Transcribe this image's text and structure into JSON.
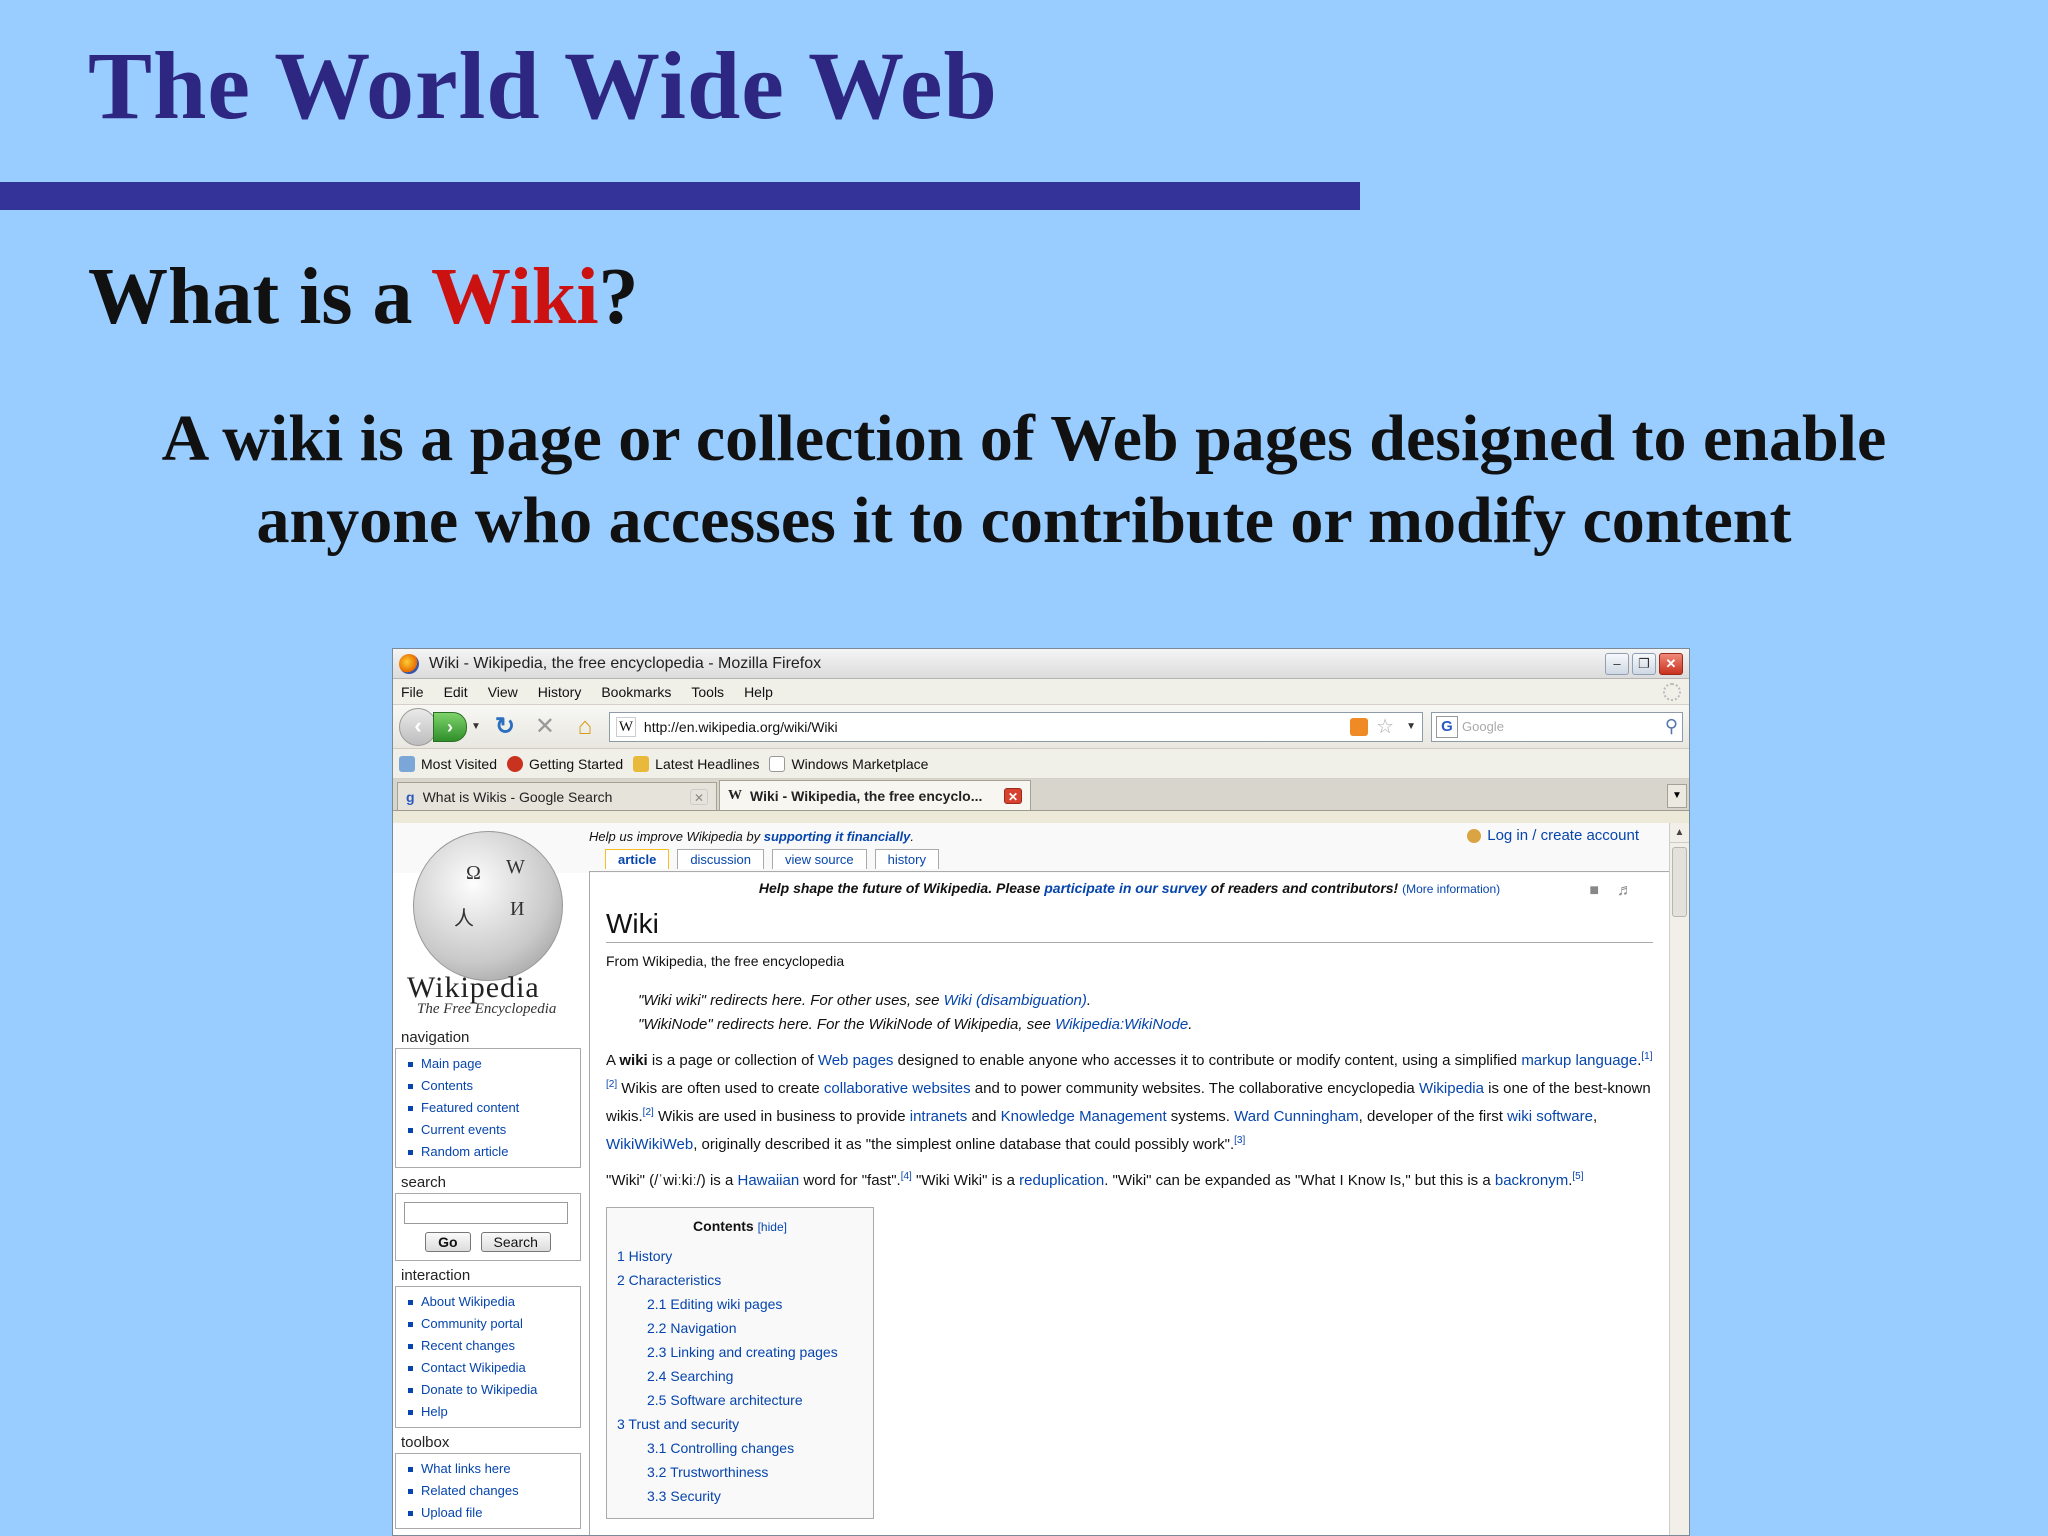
{
  "slide": {
    "title": "The World Wide Web",
    "subtitle_prefix": "What is a ",
    "subtitle_highlight": "Wiki",
    "subtitle_suffix": "?",
    "description_line1": "A wiki is a page or collection of Web pages designed to enable",
    "description_line2": "anyone who accesses it to contribute or modify content",
    "colors": {
      "title": "#2e2782",
      "rule": "#333399",
      "highlight": "#cc1111",
      "background": "#99ccff"
    }
  },
  "browser": {
    "window_title": "Wiki - Wikipedia, the free encyclopedia - Mozilla Firefox",
    "menu": [
      "File",
      "Edit",
      "View",
      "History",
      "Bookmarks",
      "Tools",
      "Help"
    ],
    "url": "http://en.wikipedia.org/wiki/Wiki",
    "favicon": "W",
    "search_placeholder": "Google",
    "bookmarks": [
      "Most Visited",
      "Getting Started",
      "Latest Headlines",
      "Windows Marketplace"
    ],
    "tabs": [
      {
        "label": "What is Wikis - Google Search",
        "active": false
      },
      {
        "label": "Wiki - Wikipedia, the free encyclo...",
        "active": true
      }
    ]
  },
  "wikipedia": {
    "improve_prefix": "Help us improve Wikipedia by ",
    "improve_link": "supporting it financially",
    "improve_suffix": ".",
    "login": "Log in / create account",
    "page_tabs": [
      "article",
      "discussion",
      "view source",
      "history"
    ],
    "logo_word": "Wikipedia",
    "logo_tagline": "The Free Encyclopedia",
    "navigation_title": "navigation",
    "navigation": [
      "Main page",
      "Contents",
      "Featured content",
      "Current events",
      "Random article"
    ],
    "search_title": "search",
    "go_label": "Go",
    "search_label": "Search",
    "interaction_title": "interaction",
    "interaction": [
      "About Wikipedia",
      "Community portal",
      "Recent changes",
      "Contact Wikipedia",
      "Donate to Wikipedia",
      "Help"
    ],
    "toolbox_title": "toolbox",
    "toolbox": [
      "What links here",
      "Related changes",
      "Upload file"
    ],
    "notice_prefix": "Help shape the future of Wikipedia. Please ",
    "notice_link": "participate in our survey",
    "notice_suffix": " of readers and contributors!",
    "notice_more": "(More information)",
    "heading": "Wiki",
    "site_sub": "From Wikipedia, the free encyclopedia",
    "dab1_text": "\"Wiki wiki\" redirects here. For other uses, see ",
    "dab1_link": "Wiki (disambiguation)",
    "dab2_text": "\"WikiNode\" redirects here. For the WikiNode of Wikipedia, see ",
    "dab2_link": "Wikipedia:WikiNode",
    "toc_title": "Contents",
    "toc_hide": "[hide]",
    "toc": [
      {
        "label": "1 History",
        "sub": false
      },
      {
        "label": "2 Characteristics",
        "sub": false
      },
      {
        "label": "2.1 Editing wiki pages",
        "sub": true
      },
      {
        "label": "2.2 Navigation",
        "sub": true
      },
      {
        "label": "2.3 Linking and creating pages",
        "sub": true
      },
      {
        "label": "2.4 Searching",
        "sub": true
      },
      {
        "label": "2.5 Software architecture",
        "sub": true
      },
      {
        "label": "3 Trust and security",
        "sub": false
      },
      {
        "label": "3.1 Controlling changes",
        "sub": true
      },
      {
        "label": "3.2 Trustworthiness",
        "sub": true
      },
      {
        "label": "3.3 Security",
        "sub": true
      }
    ]
  }
}
